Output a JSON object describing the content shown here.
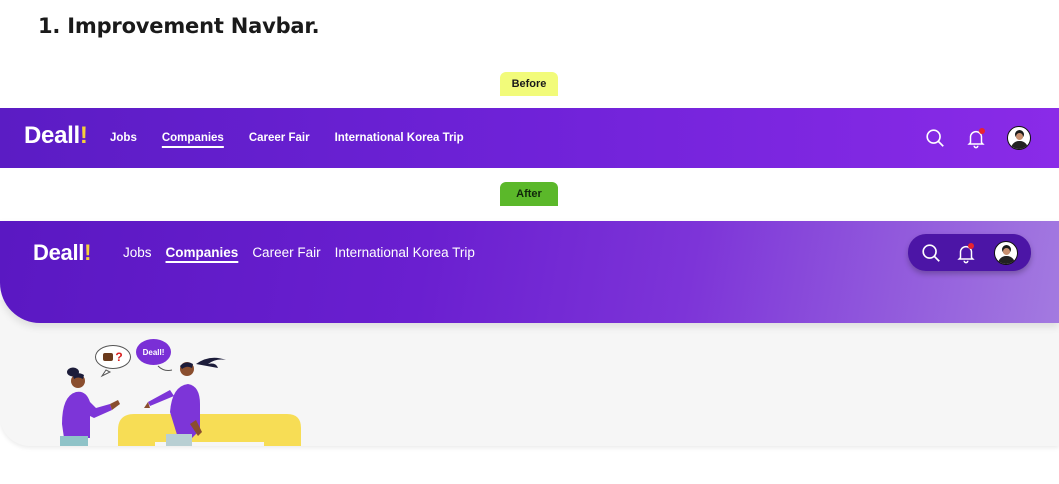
{
  "heading": "1. Improvement Navbar.",
  "labels": {
    "before": "Before",
    "after": "After"
  },
  "logo": {
    "text": "Deall",
    "accent": "!"
  },
  "nav_items": [
    "Jobs",
    "Companies",
    "Career Fair",
    "International Korea Trip"
  ],
  "active_nav_item": "Companies",
  "illustration": {
    "speech_question": "?",
    "speech_brand": "Deall!"
  },
  "colors": {
    "primary_purple": "#6a1fd0",
    "logo_accent_yellow": "#f5d03b",
    "notification_dot": "#e8232f",
    "before_tag": "#f2fb7a",
    "after_tag": "#5bb82a"
  },
  "icons": [
    "search-icon",
    "bell-icon",
    "avatar"
  ]
}
